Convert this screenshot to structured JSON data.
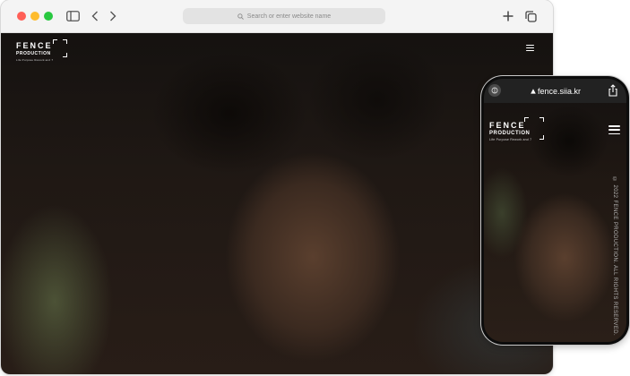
{
  "browser": {
    "address_placeholder": "Search or enter website name"
  },
  "site": {
    "logo_line1": "FENCE",
    "logo_line2": "PRODUCTION",
    "logo_line3": "Life Purpose Rework and 7",
    "hero_image": "portrait-photo"
  },
  "phone": {
    "url": "fence.siia.kr",
    "copyright": "© 2022 FENCE PRODUCTION. ALL RIGHTS RESERVED."
  },
  "colors": {
    "close": "#ff5f57",
    "minimize": "#febc2e",
    "maximize": "#28c840",
    "chrome_bg": "#f4f4f4"
  }
}
